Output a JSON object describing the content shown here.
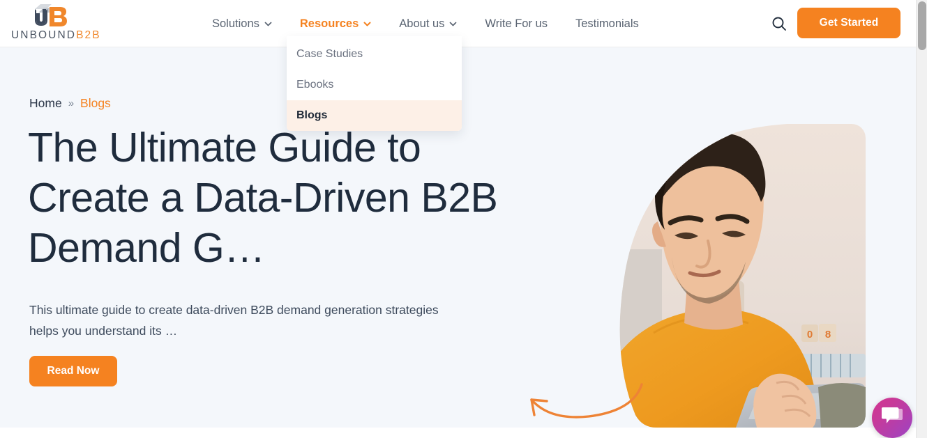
{
  "header": {
    "logo": {
      "icon": "unbound-ub-logo-icon",
      "text_dark": "UNBOUND",
      "text_orange": "B2B"
    },
    "nav_items": [
      {
        "label": "Solutions",
        "has_chevron": true,
        "active": false
      },
      {
        "label": "Resources",
        "has_chevron": true,
        "active": true
      },
      {
        "label": "About us",
        "has_chevron": true,
        "active": false
      },
      {
        "label": "Write For us",
        "has_chevron": false,
        "active": false
      },
      {
        "label": "Testimonials",
        "has_chevron": false,
        "active": false
      }
    ],
    "search_icon": "search-icon",
    "cta_label": "Get Started"
  },
  "dropdown": {
    "items": [
      {
        "label": "Case Studies",
        "active": false
      },
      {
        "label": "Ebooks",
        "active": false
      },
      {
        "label": "Blogs",
        "active": true
      }
    ]
  },
  "hero": {
    "breadcrumb": {
      "home": "Home",
      "separator": "»",
      "current": "Blogs"
    },
    "title": "The Ultimate Guide to Create a Data-Driven B2B Demand G…",
    "description": "This ultimate guide to create data-driven B2B demand generation strategies helps you understand its …",
    "read_button": "Read Now",
    "image_alt": "man-reading-tablet-photo",
    "arrow_icon": "curved-arrow-left-icon"
  },
  "chat_widget": {
    "icon": "chat-bubble-icon"
  },
  "colors": {
    "accent_orange": "#f58220",
    "hero_background": "#f4f7fb",
    "heading_dark": "#1f2c3d",
    "nav_gray": "#5a6472",
    "dropdown_active_bg": "#fdf0e7",
    "chat_gradient_start": "#d4348f",
    "chat_gradient_end": "#9c44c4"
  }
}
